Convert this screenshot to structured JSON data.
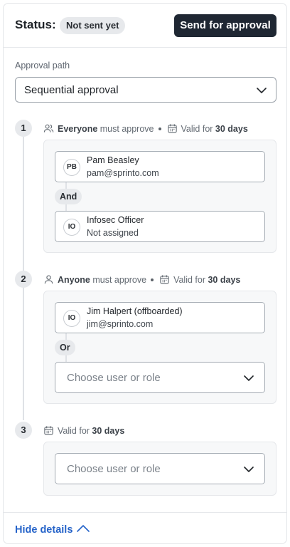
{
  "header": {
    "status_label": "Status:",
    "status_value": "Not sent yet",
    "send_button": "Send for approval"
  },
  "approval_path": {
    "label": "Approval path",
    "value": "Sequential approval"
  },
  "steps": [
    {
      "number": "1",
      "who_bold": "Everyone",
      "who_rest": "must approve",
      "valid_prefix": "Valid for",
      "valid_value": "30 days",
      "approvers": [
        {
          "initials": "PB",
          "name": "Pam Beasley",
          "sub": "pam@sprinto.com"
        },
        {
          "initials": "IO",
          "name": "Infosec Officer",
          "sub": "Not assigned"
        }
      ],
      "joiner": "And"
    },
    {
      "number": "2",
      "who_bold": "Anyone",
      "who_rest": "must approve",
      "valid_prefix": "Valid for",
      "valid_value": "30 days",
      "approvers": [
        {
          "initials": "IO",
          "name": "Jim Halpert (offboarded)",
          "sub": "jim@sprinto.com"
        }
      ],
      "joiner": "Or",
      "choose_placeholder": "Choose user or role"
    },
    {
      "number": "3",
      "valid_prefix": "Valid for",
      "valid_value": "30 days",
      "choose_placeholder": "Choose user or role"
    }
  ],
  "footer": {
    "hide_details": "Hide details"
  },
  "colors": {
    "primary_button": "#1f2733",
    "link": "#2563c9",
    "badge_bg": "#e7e9ec"
  }
}
